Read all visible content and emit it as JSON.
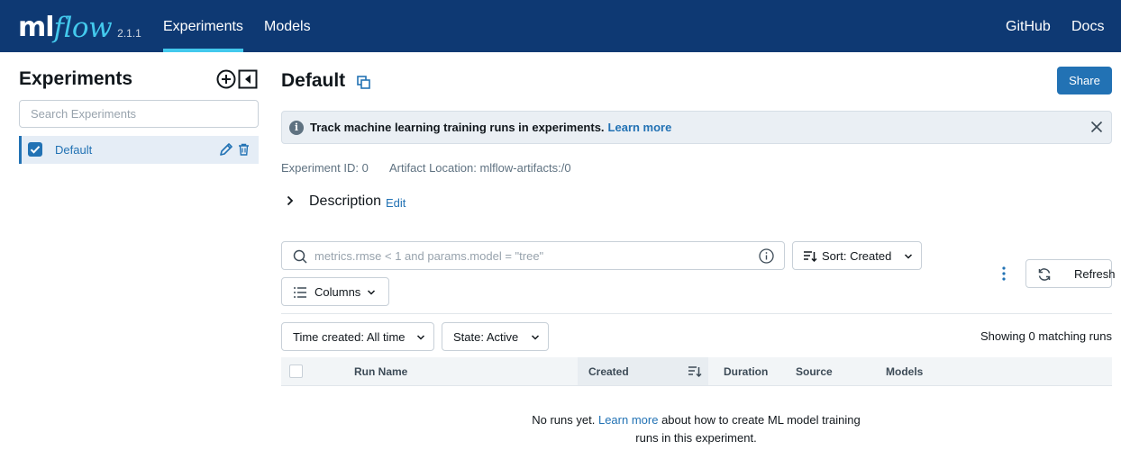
{
  "header": {
    "logo_ml": "ml",
    "logo_flow": "flow",
    "version": "2.1.1",
    "nav": [
      {
        "label": "Experiments",
        "active": true
      },
      {
        "label": "Models",
        "active": false
      }
    ],
    "right_links": [
      "GitHub",
      "Docs"
    ]
  },
  "sidebar": {
    "title": "Experiments",
    "search_placeholder": "Search Experiments",
    "items": [
      {
        "label": "Default",
        "checked": true
      }
    ]
  },
  "main": {
    "title": "Default",
    "share_label": "Share",
    "banner": {
      "text": "Track machine learning training runs in experiments.",
      "link": "Learn more"
    },
    "experiment_id": "Experiment ID: 0",
    "artifact_location": "Artifact Location: mlflow-artifacts:/0",
    "description_label": "Description",
    "description_edit": "Edit",
    "filter_placeholder": "metrics.rmse < 1 and params.model = \"tree\"",
    "sort_label": "Sort: Created",
    "columns_label": "Columns",
    "refresh_label": "Refresh",
    "time_filter": "Time created: All time",
    "state_filter": "State: Active",
    "showing": "Showing 0 matching runs",
    "table_headers": [
      "Run Name",
      "Created",
      "Duration",
      "Source",
      "Models"
    ],
    "empty_prefix": "No runs yet.",
    "empty_link": "Learn more",
    "empty_suffix_1": "about how to create ML model training",
    "empty_suffix_2": "runs in this experiment."
  },
  "colors": {
    "header_bg": "#0e3973",
    "accent": "#2272b4",
    "logo_flow": "#43c9ed"
  }
}
